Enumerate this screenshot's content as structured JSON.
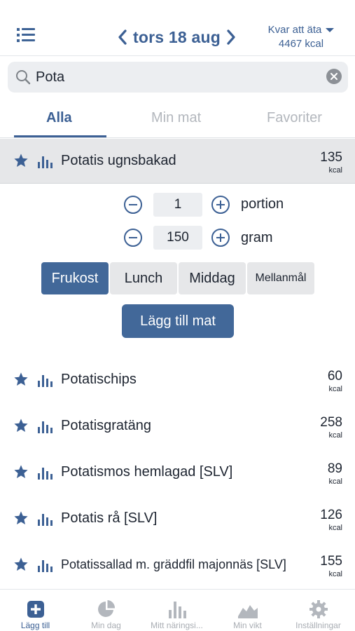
{
  "header": {
    "date": "tors 18 aug",
    "remaining_label": "Kvar att äta",
    "remaining_value": "4467 kcal"
  },
  "search": {
    "value": "Pota",
    "placeholder": ""
  },
  "tabs": [
    {
      "label": "Alla",
      "active": true
    },
    {
      "label": "Min mat",
      "active": false
    },
    {
      "label": "Favoriter",
      "active": false
    }
  ],
  "selected_item": {
    "name": "Potatis ugnsbakad",
    "kcal": "135",
    "kcal_unit": "kcal",
    "portion_qty": "1",
    "portion_unit": "portion",
    "gram_qty": "150",
    "gram_unit": "gram",
    "meals": [
      "Frukost",
      "Lunch",
      "Middag",
      "Mellanmål"
    ],
    "selected_meal": "Frukost",
    "add_button": "Lägg till mat"
  },
  "results": [
    {
      "name": "Potatischips",
      "kcal": "60",
      "unit": "kcal"
    },
    {
      "name": "Potatisgratäng",
      "kcal": "258",
      "unit": "kcal"
    },
    {
      "name": "Potatismos hemlagad [SLV]",
      "kcal": "89",
      "unit": "kcal"
    },
    {
      "name": "Potatis rå [SLV]",
      "kcal": "126",
      "unit": "kcal"
    },
    {
      "name": "Potatissallad m. gräddfil majonnäs [SLV]",
      "kcal": "155",
      "unit": "kcal"
    }
  ],
  "bottom_nav": [
    {
      "label": "Lägg till",
      "icon": "plus-square-icon",
      "active": true
    },
    {
      "label": "Min dag",
      "icon": "pie-chart-icon",
      "active": false
    },
    {
      "label": "Mitt näringsi...",
      "icon": "bar-chart-icon",
      "active": false
    },
    {
      "label": "Min vikt",
      "icon": "mountain-icon",
      "active": false
    },
    {
      "label": "Inställningar",
      "icon": "gear-icon",
      "active": false
    }
  ],
  "colors": {
    "accent": "#3c6094",
    "button": "#426899",
    "inactive": "#a9adb3"
  }
}
